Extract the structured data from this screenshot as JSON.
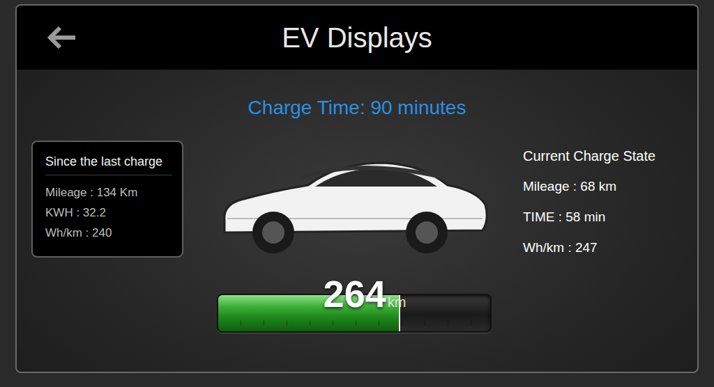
{
  "window": {
    "title": "EV Displays"
  },
  "charge_time": "Charge Time: 90 minutes",
  "since_last_charge": {
    "title": "Since the last charge",
    "rows": [
      "Mileage : 134 Km",
      "KWH : 32.2",
      "Wh/km : 240"
    ]
  },
  "current_charge_state": {
    "title": "Current Charge State",
    "rows": [
      "Mileage : 68 km",
      "TIME : 58 min",
      "Wh/km : 247"
    ]
  },
  "battery": {
    "range": "264",
    "unit": "km",
    "level": 0.67
  }
}
